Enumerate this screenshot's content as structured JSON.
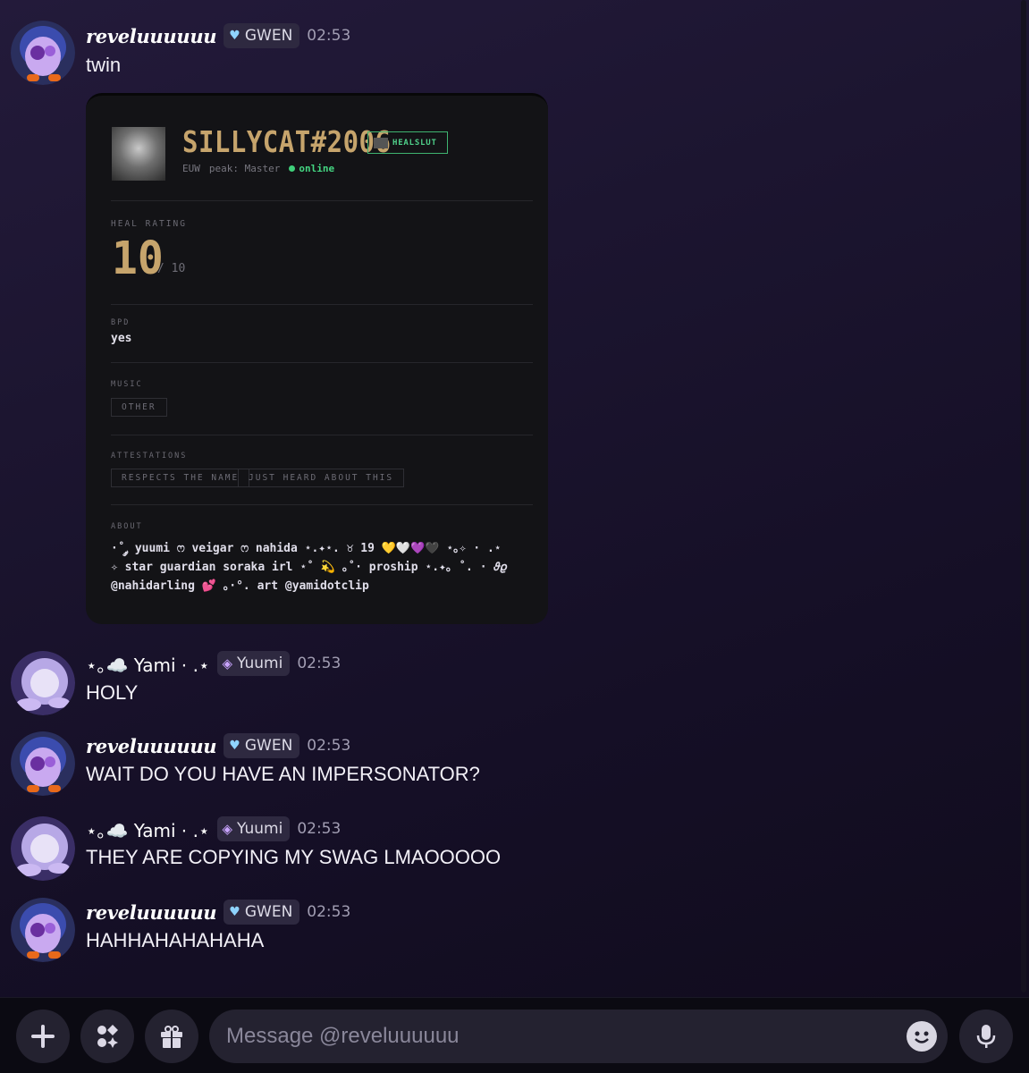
{
  "messages": [
    {
      "author": "reveluuuuuu",
      "tag": "GWEN",
      "time": "02:53",
      "text": "twin"
    },
    {
      "author": "⋆｡☁️ Yami ⋅ .⋆",
      "tag": "Yuumi",
      "time": "02:53",
      "text": "HOLY"
    },
    {
      "author": "reveluuuuuu",
      "tag": "GWEN",
      "time": "02:53",
      "text": "WAIT DO YOU HAVE AN IMPERSONATOR?"
    },
    {
      "author": "⋆｡☁️ Yami ⋅ .⋆",
      "tag": "Yuumi",
      "time": "02:53",
      "text": "THEY ARE COPYING MY SWAG LMAOOOOO"
    },
    {
      "author": "reveluuuuuu",
      "tag": "GWEN",
      "time": "02:53",
      "text": "HAHHAHAHAHAHA"
    }
  ],
  "card": {
    "name": "SILLYCAT#2006",
    "badge": "HEALSLUT",
    "region": "EUW",
    "peak": "peak: Master",
    "status": "online",
    "heal_rating_label": "HEAL RATING",
    "heal_rating": "10",
    "heal_rating_max": "/ 10",
    "bpd_label": "BPD",
    "bpd": "yes",
    "music_label": "MUSIC",
    "music": "OTHER",
    "attestations_label": "ATTESTATIONS",
    "attestations": [
      "RESPECTS THE NAME",
      "JUST HEARD ABOUT THIS"
    ],
    "about_label": "ABOUT",
    "about_lines": [
      "·˚ ༘ yuumi ෆ veigar ෆ nahida ⋆.✦⋆. ♉ 19 💛🤍💜🖤 ⋆｡✧ · .⋆",
      "✧ star guardian soraka irl ⋆˚ 💫 ｡˚· proship ⋆.✦｡ ˚. · 𝜗𝜚",
      "@nahidarling 💕 ｡·°. art @yamidotclip"
    ]
  },
  "composer": {
    "placeholder": "Message @reveluuuuuu"
  },
  "colors": {
    "gold": "#c6a46c",
    "online_green": "#3fd07a",
    "background": "#1c1530"
  }
}
